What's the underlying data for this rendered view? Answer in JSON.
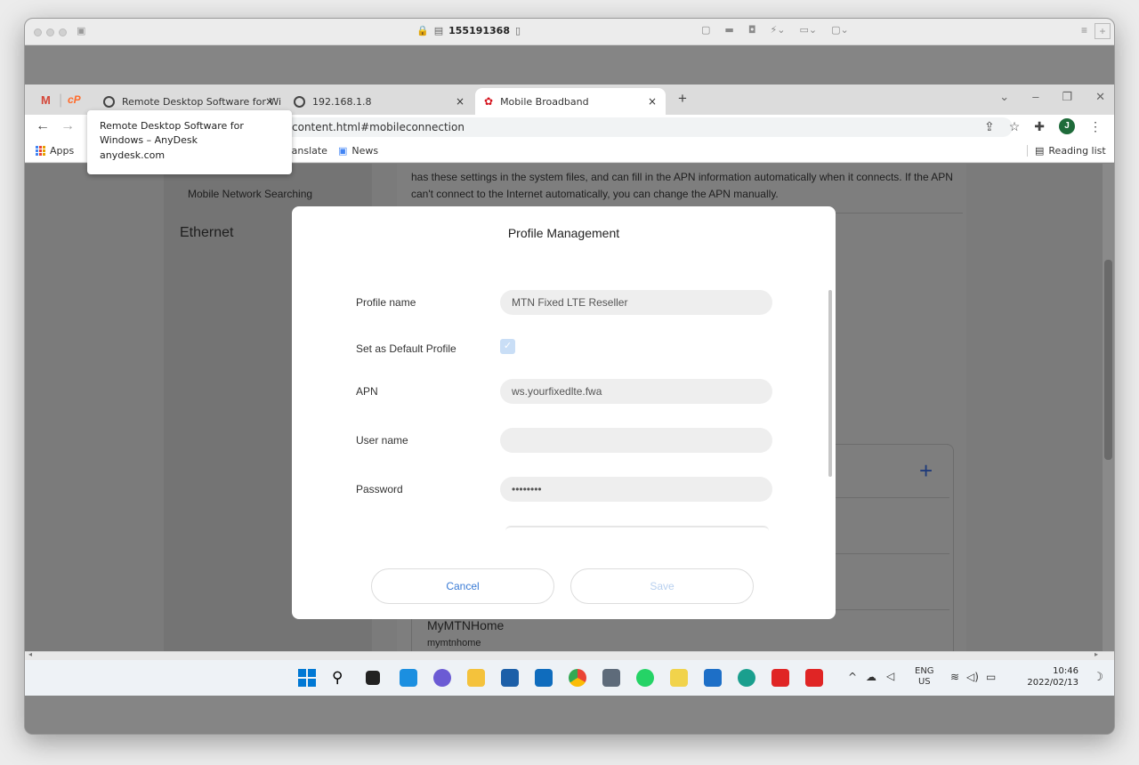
{
  "mac": {
    "title": "155191368",
    "menu_icon": "≡",
    "plus": "+"
  },
  "browser": {
    "tabs": [
      {
        "label": "Remote Desktop Software for Wi",
        "icon": "globe-icon",
        "close": "×"
      },
      {
        "label": "192.168.1.8",
        "icon": "globe-icon",
        "close": "×"
      },
      {
        "label": "Mobile Broadband",
        "icon": "huawei-icon",
        "close": "×"
      }
    ],
    "new_tab": "+",
    "pinned": {
      "gmail": "M",
      "cpanel": "cP"
    },
    "url": "content.html#mobileconnection",
    "avatar": "J",
    "bookmarks": {
      "apps": "Apps",
      "translate": "Translate",
      "news": "News",
      "reading_list": "Reading list"
    }
  },
  "tooltip": {
    "title": "Remote Desktop Software for Windows – AnyDesk",
    "domain": "anydesk.com"
  },
  "page": {
    "sidebar_item": "Mobile Network Searching",
    "sidebar_section": "Ethernet",
    "description": "has these settings in the system files, and can fill in the APN information automatically when it connects. If the APN can't connect to the Internet automatically, you can change the APN manually.",
    "profile_list_item": "MyMTNHome",
    "profile_list_sub": "mymtnhome",
    "add_icon": "+"
  },
  "modal": {
    "title": "Profile Management",
    "fields": {
      "profile_name_label": "Profile name",
      "profile_name_value": "MTN Fixed LTE Reseller",
      "default_label": "Set as Default Profile",
      "default_checked": true,
      "apn_label": "APN",
      "apn_value": "ws.yourfixedlte.fwa",
      "username_label": "User name",
      "username_value": "",
      "password_label": "Password",
      "password_value": "••••••••"
    },
    "cancel_label": "Cancel",
    "save_label": "Save"
  },
  "taskbar": {
    "tray_lang": "ENG",
    "tray_region": "US",
    "time": "10:46",
    "date": "2022/02/13"
  }
}
